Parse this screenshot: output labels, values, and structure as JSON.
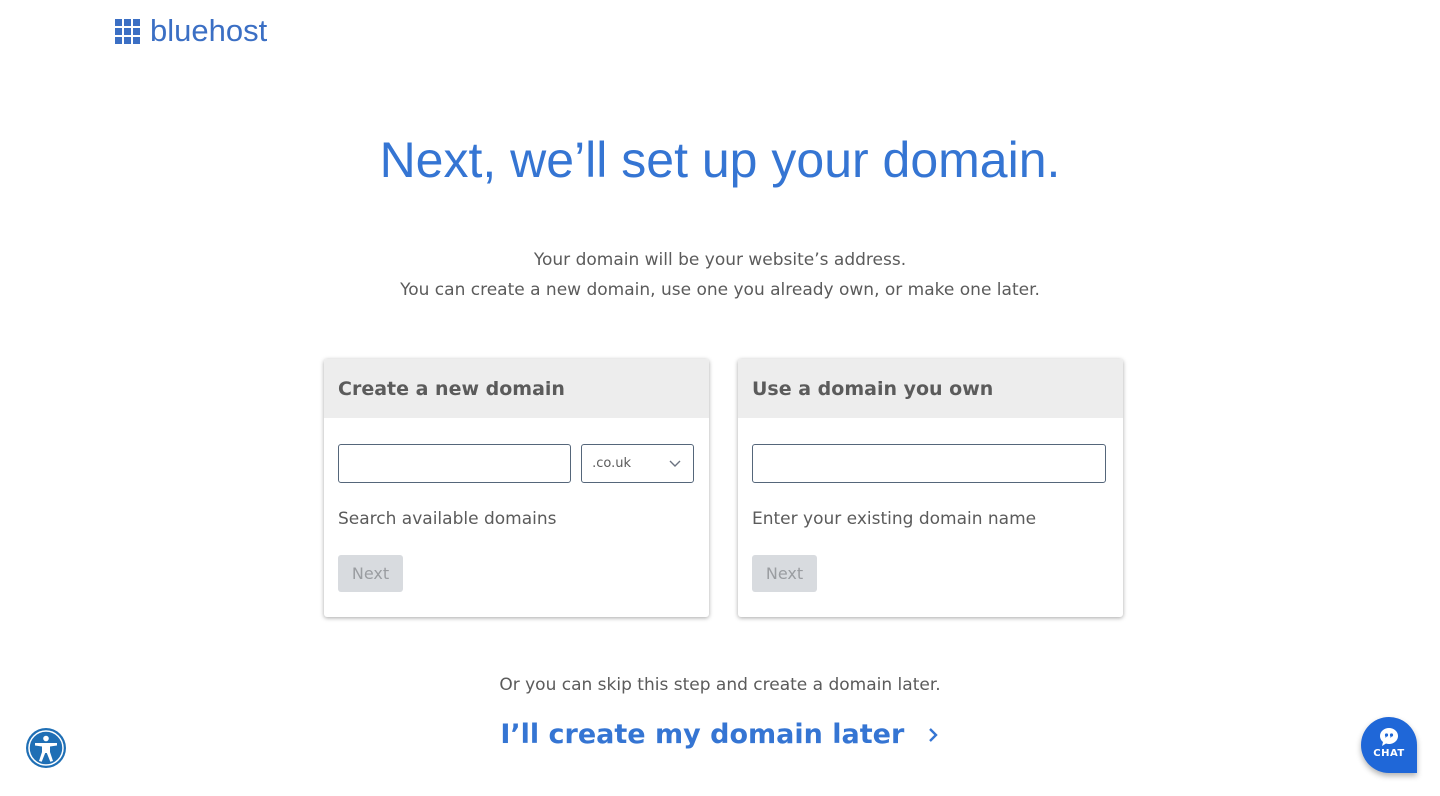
{
  "header": {
    "logo_text": "bluehost",
    "logo_icon": "grid-icon"
  },
  "main": {
    "title": "Next, we’ll set up your domain.",
    "subtitle_line1": "Your domain will be your website’s address.",
    "subtitle_line2": "You can create a new domain, use one you already own, or make one later."
  },
  "cards": {
    "new_domain": {
      "title": "Create a new domain",
      "input_value": "",
      "input_placeholder": "",
      "tld_selected": ".co.uk",
      "helper": "Search available domains",
      "next_label": "Next",
      "next_disabled": true
    },
    "own_domain": {
      "title": "Use a domain you own",
      "input_value": "",
      "input_placeholder": "",
      "helper": "Enter your existing domain name",
      "next_label": "Next",
      "next_disabled": true
    }
  },
  "footer": {
    "skip_text": "Or you can skip this step and create a domain later.",
    "later_link": "I’ll create my domain later"
  },
  "widgets": {
    "accessibility_icon": "accessibility-icon",
    "chat_label": "CHAT"
  },
  "colors": {
    "brand_blue": "#3575d3",
    "logo_blue": "#3b6fc4",
    "chat_blue": "#1f67d8",
    "disabled_button": "#d8dbdf"
  }
}
